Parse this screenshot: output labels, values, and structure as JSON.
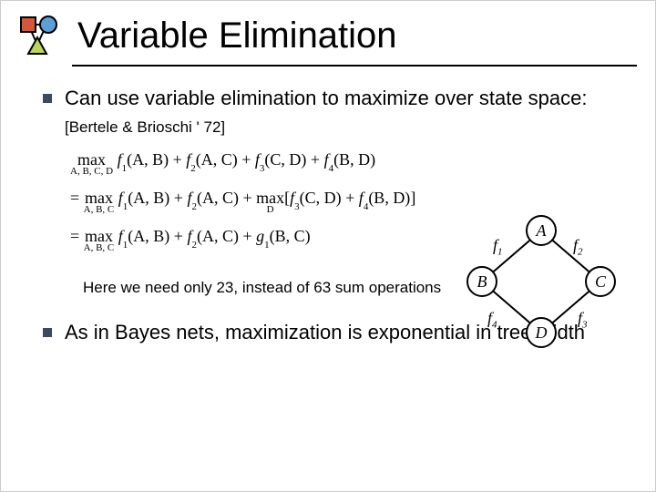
{
  "title": "Variable Elimination",
  "bullets": [
    {
      "text": "Can use variable elimination to maximize over state space:",
      "citation": "[Bertele & Brioschi ' 72]"
    },
    {
      "text": "As in Bayes nets, maximization is exponential in tree-width"
    }
  ],
  "math": {
    "line1": {
      "maxvars": "A, B, C, D",
      "expr_parts": [
        "f",
        "1",
        "(A, B) + ",
        "f",
        "2",
        "(A, C) + ",
        "f",
        "3",
        "(C, D) + ",
        "f",
        "4",
        "(B, D)"
      ]
    },
    "line2": {
      "prefix": "=",
      "maxvars1": "A, B, C",
      "mid1_parts": [
        "f",
        "1",
        "(A, B) + ",
        "f",
        "2",
        "(A, C) +"
      ],
      "maxvars2": "D",
      "tail_parts": [
        "[",
        "f",
        "3",
        "(C, D) + ",
        "f",
        "4",
        "(B, D)",
        "]"
      ]
    },
    "line3": {
      "prefix": "=",
      "maxvars": "A, B, C",
      "expr_parts": [
        "f",
        "1",
        "(A, B) + ",
        "f",
        "2",
        "(A, C) + ",
        "g",
        "1",
        "(B, C)"
      ]
    }
  },
  "note": "Here we need only 23, instead of 63 sum operations",
  "graph": {
    "nodes": {
      "A": "A",
      "B": "B",
      "C": "C",
      "D": "D"
    },
    "edges": {
      "f1": "f",
      "f1s": "1",
      "f2": "f",
      "f2s": "2",
      "f3": "f",
      "f3s": "3",
      "f4": "f",
      "f4s": "4"
    }
  }
}
